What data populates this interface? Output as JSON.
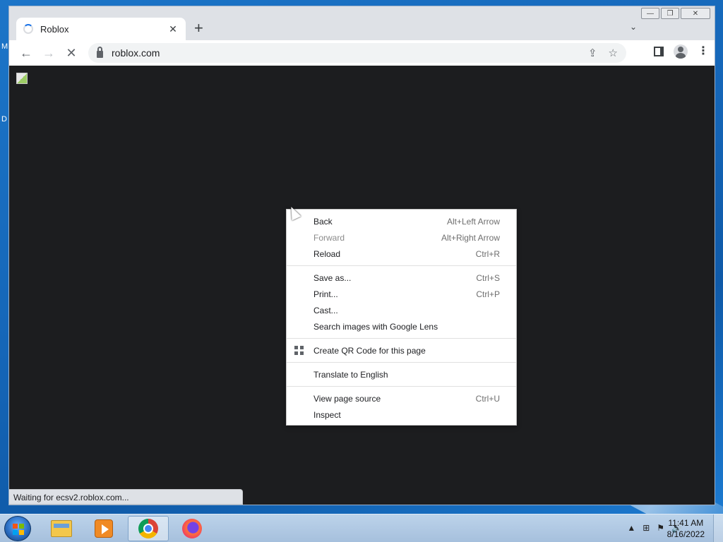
{
  "desktop": {
    "letters": [
      "M",
      "D"
    ]
  },
  "browser": {
    "tab": {
      "title": "Roblox",
      "close": "✕"
    },
    "new_tab": "+",
    "tab_search": "⌄",
    "window_controls": {
      "minimize": "—",
      "restore": "❐",
      "close": "✕"
    },
    "nav": {
      "back": "←",
      "forward": "→",
      "stop": "✕"
    },
    "omnibox": {
      "url": "roblox.com"
    },
    "toolbar_icons": {
      "share": "⇪",
      "bookmark": "☆",
      "menu": "⋮"
    },
    "status_text": "Waiting for ecsv2.roblox.com..."
  },
  "context_menu": {
    "groups": [
      [
        {
          "label": "Back",
          "shortcut": "Alt+Left Arrow",
          "disabled": false
        },
        {
          "label": "Forward",
          "shortcut": "Alt+Right Arrow",
          "disabled": true
        },
        {
          "label": "Reload",
          "shortcut": "Ctrl+R",
          "disabled": false
        }
      ],
      [
        {
          "label": "Save as...",
          "shortcut": "Ctrl+S",
          "disabled": false
        },
        {
          "label": "Print...",
          "shortcut": "Ctrl+P",
          "disabled": false
        },
        {
          "label": "Cast...",
          "shortcut": "",
          "disabled": false
        },
        {
          "label": "Search images with Google Lens",
          "shortcut": "",
          "disabled": false
        }
      ],
      [
        {
          "label": "Create QR Code for this page",
          "shortcut": "",
          "disabled": false,
          "icon": "qr-code-icon"
        }
      ],
      [
        {
          "label": "Translate to English",
          "shortcut": "",
          "disabled": false
        }
      ],
      [
        {
          "label": "View page source",
          "shortcut": "Ctrl+U",
          "disabled": false
        },
        {
          "label": "Inspect",
          "shortcut": "",
          "disabled": false
        }
      ]
    ]
  },
  "taskbar": {
    "apps": [
      "file-explorer",
      "media-player",
      "chrome",
      "firefox"
    ],
    "tray_icons": {
      "show_hidden": "▲",
      "network": "⊞",
      "action_center": "⚑",
      "volume": "🔊"
    },
    "clock": {
      "time": "11:41 AM",
      "date": "8/16/2022"
    }
  }
}
